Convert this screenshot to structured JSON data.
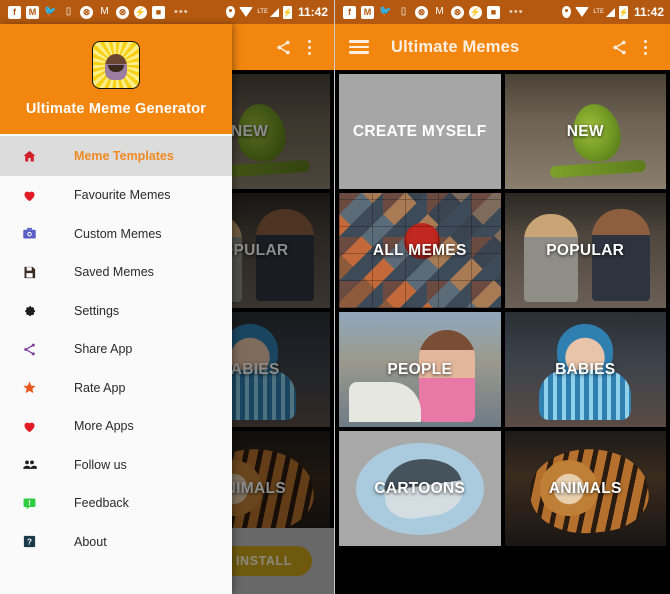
{
  "statusbar": {
    "notification_icons": [
      "facebook-icon",
      "gmail-icon",
      "twitter-icon",
      "inbox-icon",
      "firefox-icon",
      "gmail-m-icon",
      "firefox-icon-2",
      "messenger-icon",
      "gallery-icon"
    ],
    "overflow_dots": "•••",
    "location_icon": "location-pin-icon",
    "wifi_icon": "wifi-icon",
    "network_label": "LTE",
    "battery_icon": "battery-charging-icon",
    "time": "11:42"
  },
  "left_phone": {
    "appbar": {
      "share_icon": "share-icon",
      "overflow_icon": "more-vert-icon"
    },
    "ad": {
      "install_label": "INSTALL"
    }
  },
  "right_phone": {
    "appbar": {
      "menu_icon": "hamburger-menu-icon",
      "title": "Ultimate Memes",
      "share_icon": "share-icon",
      "overflow_icon": "more-vert-icon"
    }
  },
  "drawer": {
    "app_icon": "app-logo-icon",
    "app_title": "Ultimate Meme Generator",
    "items": [
      {
        "label": "Meme Templates",
        "icon": "home-icon",
        "active": true,
        "color": "#d0202a"
      },
      {
        "label": "Favourite Memes",
        "icon": "heart-icon",
        "active": false,
        "color": "#e01b24"
      },
      {
        "label": "Custom Memes",
        "icon": "camera-icon",
        "active": false,
        "color": "#5a5fc4"
      },
      {
        "label": "Saved Memes",
        "icon": "save-icon",
        "active": false,
        "color": "#3b2a20"
      },
      {
        "label": "Settings",
        "icon": "gear-icon",
        "active": false,
        "color": "#1d1d1d"
      },
      {
        "label": "Share App",
        "icon": "share-icon",
        "active": false,
        "color": "#7b3f9d"
      },
      {
        "label": "Rate App",
        "icon": "star-icon",
        "active": false,
        "color": "#e8581c"
      },
      {
        "label": "More Apps",
        "icon": "heart-icon",
        "active": false,
        "color": "#e01b24"
      },
      {
        "label": "Follow us",
        "icon": "people-icon",
        "active": false,
        "color": "#1d1d1d"
      },
      {
        "label": "Feedback",
        "icon": "feedback-icon",
        "active": false,
        "color": "#2ecc40"
      },
      {
        "label": "About",
        "icon": "help-icon",
        "active": false,
        "color": "#1b3a4b"
      }
    ]
  },
  "grid": {
    "tiles": [
      {
        "label": "CREATE MYSELF",
        "art": "art-plain",
        "name": "tile-create-myself"
      },
      {
        "label": "NEW",
        "art": "art-frog",
        "name": "tile-new"
      },
      {
        "label": "ALL MEMES",
        "art": "art-collage",
        "name": "tile-all-memes"
      },
      {
        "label": "POPULAR",
        "art": "art-couple",
        "name": "tile-popular"
      },
      {
        "label": "PEOPLE",
        "art": "art-people",
        "name": "tile-people"
      },
      {
        "label": "BABIES",
        "art": "art-baby",
        "name": "tile-babies"
      },
      {
        "label": "CARTOONS",
        "art": "art-shark",
        "name": "tile-cartoons"
      },
      {
        "label": "ANIMALS",
        "art": "art-tiger",
        "name": "tile-animals"
      }
    ]
  },
  "colors": {
    "brand_orange": "#f2860f",
    "statusbar_orange": "#b4590f",
    "drawer_bg": "#fafafa",
    "active_item_bg": "#dcdcdc",
    "active_item_text": "#ef8a22",
    "install_gold": "#c8a31a"
  }
}
